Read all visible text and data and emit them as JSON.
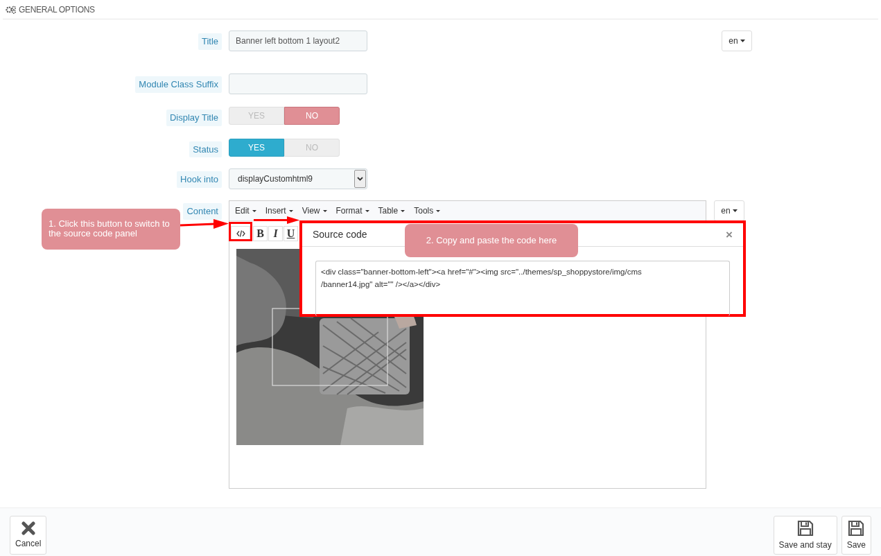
{
  "section_title": "GENERAL OPTIONS",
  "fields": [
    {
      "kind": "text",
      "label": "Title",
      "value": "Banner left bottom 1 layout2",
      "language": "en"
    },
    {
      "kind": "text",
      "label": "Module Class Suffix"
    },
    {
      "kind": "toggle",
      "label": "Display Title",
      "options": [
        {
          "label": "YES",
          "selected": false
        },
        {
          "label": "NO",
          "selected": true
        }
      ]
    },
    {
      "kind": "toggle",
      "label": "Status",
      "options": [
        {
          "label": "YES",
          "selected": true
        },
        {
          "label": "NO",
          "selected": false
        }
      ]
    },
    {
      "kind": "select",
      "label": "Hook into",
      "value": "displayCustomhtml9"
    },
    {
      "kind": "editor",
      "label": "Content",
      "language": "en",
      "menu": [
        "Edit",
        "Insert",
        "View",
        "Format",
        "Table",
        "Tools"
      ],
      "format_buttons": [
        "B",
        "I",
        "U"
      ]
    }
  ],
  "dialog": {
    "title": "Source code",
    "close": "×",
    "code": "<div class=\"banner-bottom-left\"><a href=\"#\"><img src=\"../themes/sp_shoppystore/img/cms\n/banner14.jpg\" alt=\"\" /></a></div>"
  },
  "callouts": [
    "1. Click this button to switch to the source code panel",
    "2. Copy and paste the code here"
  ],
  "footer": {
    "left": [
      {
        "label": "Cancel",
        "kind": "cancel"
      }
    ],
    "right": [
      {
        "label": "Save and stay",
        "kind": "save"
      },
      {
        "label": "Save",
        "kind": "save"
      }
    ]
  }
}
